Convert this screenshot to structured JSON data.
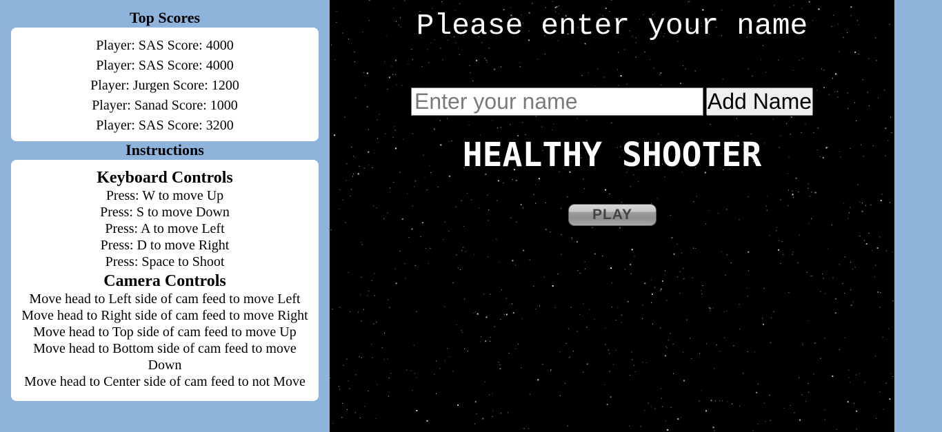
{
  "sidebar": {
    "top_scores_title": "Top Scores",
    "scores": [
      "Player: SAS Score: 4000",
      "Player: SAS Score: 4000",
      "Player: Jurgen Score: 1200",
      "Player: Sanad Score: 1000",
      "Player: SAS Score: 3200"
    ],
    "instructions_title": "Instructions",
    "keyboard_heading": "Keyboard Controls",
    "keyboard_lines": [
      "Press: W to move Up",
      "Press: S to move Down",
      "Press: A to move Left",
      "Press: D to move Right",
      "Press: Space to Shoot"
    ],
    "camera_heading": "Camera Controls",
    "camera_lines": [
      "Move head to Left side of cam feed to move Left",
      "Move head to Right side of cam feed to move Right",
      "Move head to Top side of cam feed to move Up",
      "Move head to Bottom side of cam feed to move Down",
      "Move head to Center side of cam feed to not Move"
    ]
  },
  "game": {
    "prompt": "Please enter your name",
    "name_input": {
      "placeholder": "Enter your name",
      "value": ""
    },
    "add_name_label": "Add Name",
    "title": "HEALTHY SHOOTER",
    "play_label": "PLAY"
  },
  "colors": {
    "page_background": "#8fb4dc",
    "game_background": "#000000",
    "panel_background": "#ffffff"
  }
}
